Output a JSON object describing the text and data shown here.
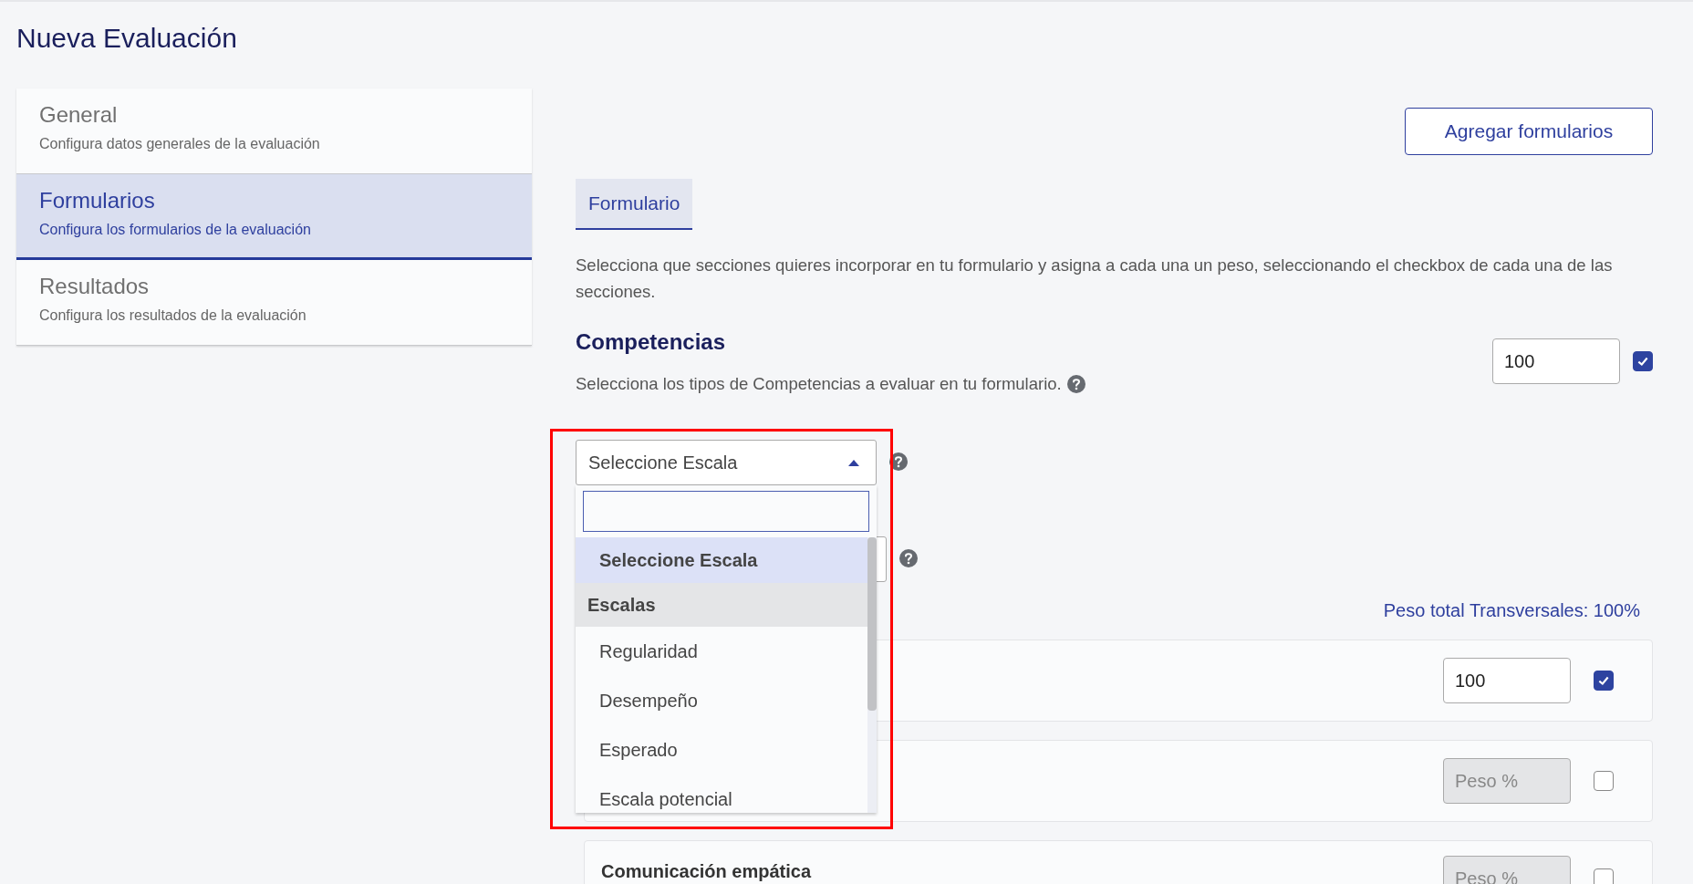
{
  "page": {
    "title": "Nueva Evaluación"
  },
  "sidebar": {
    "items": [
      {
        "title": "General",
        "subtitle": "Configura datos generales de la evaluación",
        "selected": false
      },
      {
        "title": "Formularios",
        "subtitle": "Configura los formularios de la evaluación",
        "selected": true
      },
      {
        "title": "Resultados",
        "subtitle": "Configura los resultados de la evaluación",
        "selected": false
      }
    ]
  },
  "add_button": "Agregar formularios",
  "tabs": [
    {
      "label": "Formulario",
      "selected": true
    }
  ],
  "description": "Selecciona que secciones quieres incorporar en tu formulario y asigna a cada una un peso, seleccionando el checkbox de cada una de las secciones.",
  "competencias": {
    "title": "Competencias",
    "weight": "100",
    "checked": true,
    "subtitle": "Selecciona los tipos de Competencias a evaluar en tu formulario."
  },
  "scale_select": {
    "value": "Seleccione Escala",
    "expanded": true,
    "options": [
      {
        "kind": "option",
        "label": "Seleccione Escala",
        "selected": true
      },
      {
        "kind": "group",
        "label": "Escalas"
      },
      {
        "kind": "option",
        "label": "Regularidad",
        "selected": false
      },
      {
        "kind": "option",
        "label": "Desempeño",
        "selected": false
      },
      {
        "kind": "option",
        "label": "Esperado",
        "selected": false
      },
      {
        "kind": "option",
        "label": "Escala potencial",
        "selected": false
      }
    ]
  },
  "total_weight": "Peso total Transversales: 100%",
  "cards": [
    {
      "weight": "100",
      "checked": true
    },
    {
      "placeholder": "Peso %",
      "checked": false
    },
    {
      "title": "Comunicación empática",
      "placeholder": "Peso %",
      "checked": false
    }
  ]
}
